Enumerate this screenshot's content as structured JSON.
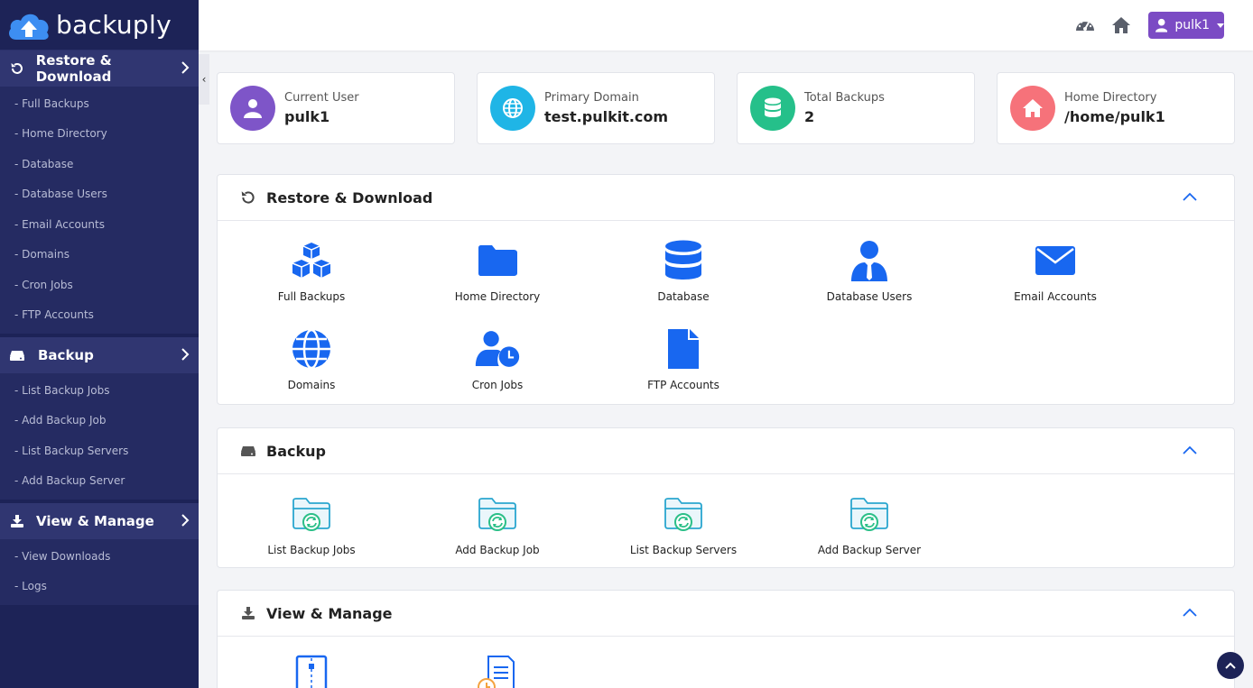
{
  "brand": {
    "name": "backuply"
  },
  "sidebar": {
    "sections": [
      {
        "title": "Restore & Download",
        "items": [
          "- Full Backups",
          "- Home Directory",
          "- Database",
          "- Database Users",
          "- Email Accounts",
          "- Domains",
          "- Cron Jobs",
          "- FTP Accounts"
        ]
      },
      {
        "title": "Backup",
        "items": [
          "- List Backup Jobs",
          "- Add Backup Job",
          "- List Backup Servers",
          "- Add Backup Server"
        ]
      },
      {
        "title": "View & Manage",
        "items": [
          "- View Downloads",
          "- Logs"
        ]
      }
    ]
  },
  "topbar": {
    "user_label": "pulk1"
  },
  "info_cards": [
    {
      "label": "Current User",
      "value": "pulk1",
      "color": "#7e55c8"
    },
    {
      "label": "Primary Domain",
      "value": "test.pulkit.com",
      "color": "#1fb5e6"
    },
    {
      "label": "Total Backups",
      "value": "2",
      "color": "#25c08a"
    },
    {
      "label": "Home Directory",
      "value": "/home/pulk1",
      "color": "#f6727a"
    }
  ],
  "panels": {
    "restore": {
      "title": "Restore & Download",
      "tiles": [
        "Full Backups",
        "Home Directory",
        "Database",
        "Database Users",
        "Email Accounts",
        "Domains",
        "Cron Jobs",
        "FTP Accounts"
      ]
    },
    "backup": {
      "title": "Backup",
      "tiles": [
        "List Backup Jobs",
        "Add Backup Job",
        "List Backup Servers",
        "Add Backup Server"
      ]
    },
    "manage": {
      "title": "View & Manage"
    }
  },
  "colors": {
    "accent_blue": "#1867f0",
    "sidebar_bg": "#1d2357",
    "user_button": "#7b4bc4"
  }
}
